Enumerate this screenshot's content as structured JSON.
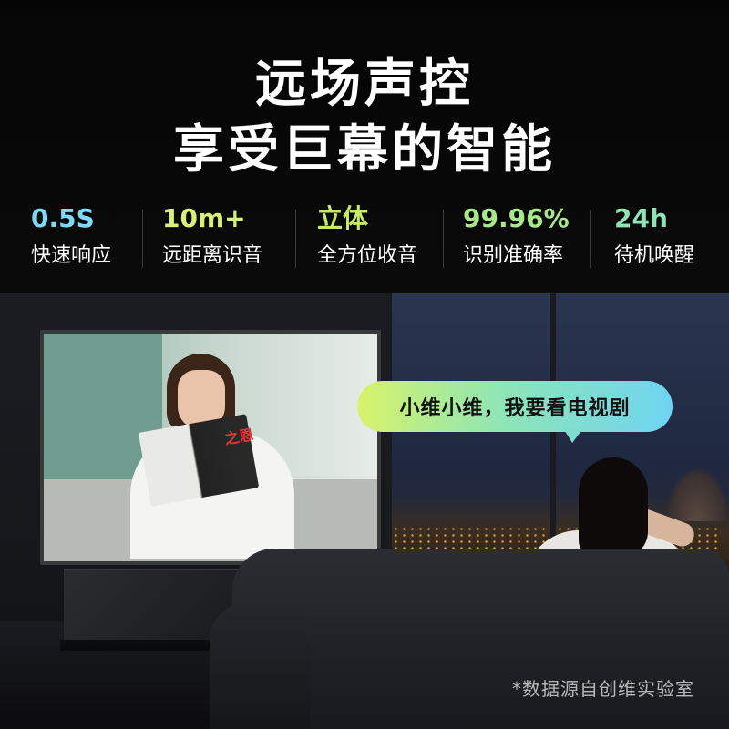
{
  "headline": {
    "line1": "远场声控",
    "line2": "享受巨幕的智能"
  },
  "stats": [
    {
      "value": "0.5S",
      "label": "快速响应",
      "color": "#7fd8f4"
    },
    {
      "value": "10m+",
      "label": "远距离识音",
      "color": "#d8ef7a"
    },
    {
      "value": "立体",
      "label": "全方位收音",
      "color": "#c8ea6a"
    },
    {
      "value": "99.96%",
      "label": "识别准确率",
      "color": "#a9e88a"
    },
    {
      "value": "24h",
      "label": "待机唤醒",
      "color": "#8fe3b4"
    }
  ],
  "tv_screen": {
    "book_title": "之恩"
  },
  "speech_bubble": {
    "text": "小维小维，我要看电视剧"
  },
  "footnote": "*数据源自创维实验室",
  "colors": {
    "background": "#050505",
    "bubble_gradient": [
      "#d8f36a",
      "#8fe5b5",
      "#6fd4f2"
    ]
  }
}
